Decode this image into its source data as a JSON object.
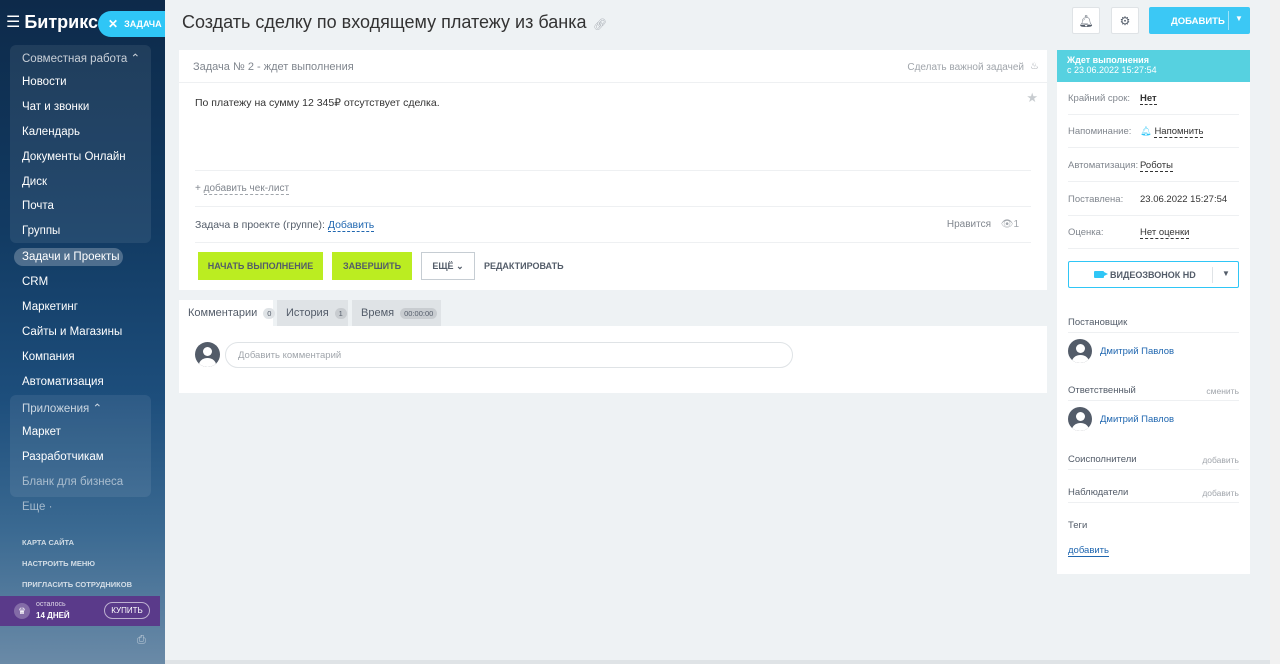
{
  "sidebar": {
    "brand": "Битрикс 24",
    "task_pill": "ЗАДАЧА",
    "group1_header": "Совместная работа",
    "group1_items": [
      "Новости",
      "Чат и звонки",
      "Календарь",
      "Документы Онлайн",
      "Диск",
      "Почта",
      "Группы"
    ],
    "active_item": "Задачи и Проекты",
    "items": [
      "CRM",
      "Маркетинг",
      "Сайты и Магазины",
      "Компания",
      "Автоматизация"
    ],
    "group2_header": "Приложения",
    "group2_items": [
      "Маркет",
      "Разработчикам",
      "Бланк для бизнеса"
    ],
    "more": "Еще ·",
    "small_links": [
      "КАРТА САЙТА",
      "НАСТРОИТЬ МЕНЮ",
      "ПРИГЛАСИТЬ СОТРУДНИКОВ"
    ],
    "trial_label": "осталось",
    "trial_days": "14 ДНЕЙ",
    "buy": "КУПИТЬ"
  },
  "header": {
    "title": "Создать сделку по входящему платежу из банка",
    "add_button": "ДОБАВИТЬ"
  },
  "task": {
    "status_line": "Задача № 2 - ждет выполнения",
    "make_important": "Сделать важной задачей",
    "description": "По платежу на сумму 12 345₽ отсутствует сделка.",
    "add_checklist": "добавить чек-лист",
    "project_label": "Задача в проекте (группе):",
    "project_add": "Добавить",
    "likes": "Нравится",
    "views": "1",
    "btn_start": "НАЧАТЬ ВЫПОЛНЕНИЕ",
    "btn_finish": "ЗАВЕРШИТЬ",
    "btn_more": "ЕЩЁ",
    "btn_edit": "РЕДАКТИРОВАТЬ"
  },
  "tabs": [
    {
      "label": "Комментарии",
      "count": "0"
    },
    {
      "label": "История",
      "count": "1"
    },
    {
      "label": "Время",
      "count": "00:00:00"
    }
  ],
  "comment": {
    "placeholder": "Добавить комментарий"
  },
  "panel": {
    "status_title": "Ждет выполнения",
    "status_since": "с 23.06.2022 15:27:54",
    "rows": [
      {
        "key": "Крайний срок:",
        "value": "Нет"
      },
      {
        "key": "Напоминание:",
        "value": "Напомнить"
      },
      {
        "key": "Автоматизация:",
        "value": "Роботы"
      },
      {
        "key": "Поставлена:",
        "value": "23.06.2022 15:27:54"
      },
      {
        "key": "Оценка:",
        "value": "Нет оценки"
      }
    ],
    "video_button": "ВИДЕОЗВОНОК HD",
    "creator_label": "Постановщик",
    "creator_name": "Дмитрий Павлов",
    "responsible_label": "Ответственный",
    "responsible_change": "сменить",
    "responsible_name": "Дмитрий Павлов",
    "coexecutors_label": "Соисполнители",
    "coexecutors_add": "добавить",
    "observers_label": "Наблюдатели",
    "observers_add": "добавить",
    "tags_label": "Теги",
    "tags_add": "добавить"
  }
}
